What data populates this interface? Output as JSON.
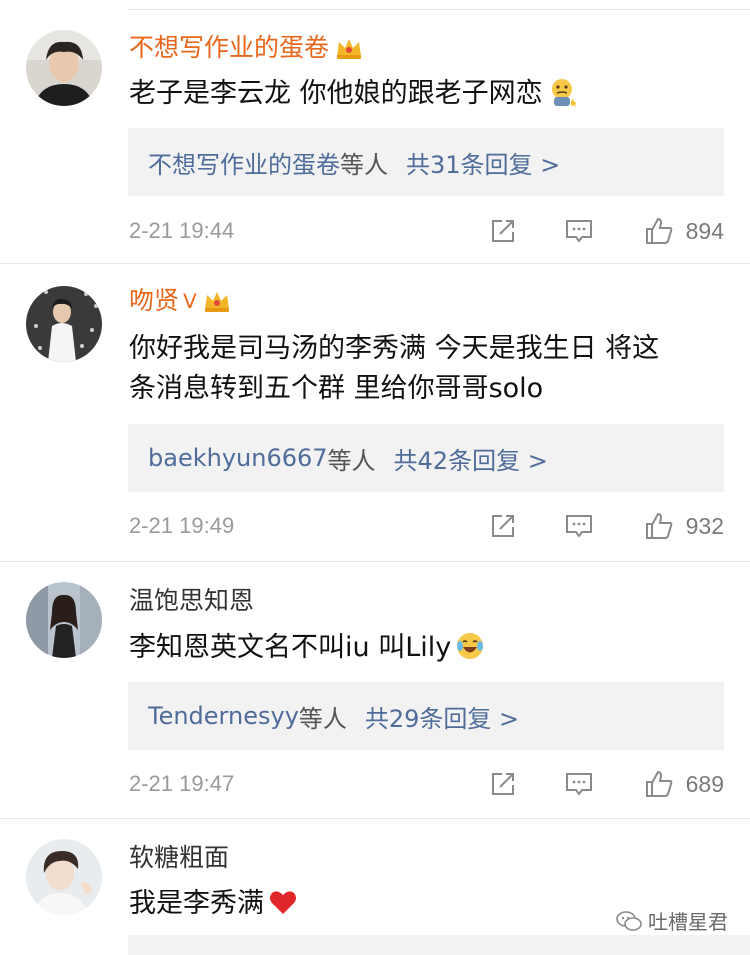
{
  "comments": [
    {
      "username": "不想写作业的蛋卷",
      "vip": true,
      "vip_mark": "",
      "text": "老子是李云龙 你他娘的跟老子网恋",
      "emoji": "thinking-emoji",
      "reply_from": "不想写作业的蛋卷",
      "reply_etc": "等人",
      "reply_count": "共31条回复 >",
      "time": "2-21 19:44",
      "likes": "894"
    },
    {
      "username": "吻贤",
      "vip": true,
      "vip_mark": "ᐯ",
      "text_lines": [
        "你好我是司马汤的李秀满 今天是我生日 将这",
        "条消息转到五个群 里给你哥哥solo"
      ],
      "reply_from": "baekhyun6667",
      "reply_etc": "等人",
      "reply_count": "共42条回复 >",
      "time": "2-21 19:49",
      "likes": "932"
    },
    {
      "username": "温饱思知恩",
      "vip": false,
      "text": "李知恩英文名不叫iu 叫Lily",
      "emoji": "laugh-cry-emoji",
      "reply_from": "Tendernesyy",
      "reply_etc": "等人",
      "reply_count": "共29条回复 >",
      "time": "2-21 19:47",
      "likes": "689"
    },
    {
      "username": "软糖粗面",
      "vip": false,
      "text": "我是李秀满",
      "emoji": "red-heart-emoji"
    }
  ],
  "watermark": "吐槽星君",
  "colors": {
    "vip_name": "#e8671c",
    "link": "#4f6c9a",
    "reply_bg": "#f2f2f2",
    "meta": "#9a9a9a"
  }
}
